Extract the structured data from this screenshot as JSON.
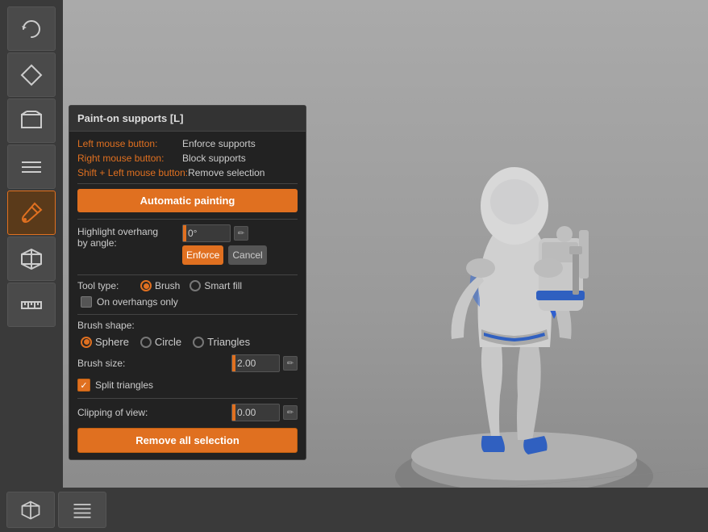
{
  "viewport": {
    "background": "#8c8c8c"
  },
  "toolbar": {
    "buttons": [
      {
        "id": "rotate",
        "icon": "↺",
        "label": "Rotate",
        "active": false
      },
      {
        "id": "diamond",
        "icon": "◇",
        "label": "Diamond",
        "active": false
      },
      {
        "id": "square",
        "icon": "▭",
        "label": "Square",
        "active": false
      },
      {
        "id": "layers",
        "icon": "≡",
        "label": "Layers",
        "active": false
      },
      {
        "id": "paintbrush",
        "icon": "🖌",
        "label": "Paint brush",
        "active": true
      },
      {
        "id": "cube",
        "icon": "⬡",
        "label": "Cube",
        "active": false
      },
      {
        "id": "ruler",
        "icon": "📏",
        "label": "Ruler",
        "active": false
      }
    ]
  },
  "panel": {
    "title": "Paint-on supports [L]",
    "left_mouse_label": "Left mouse button:",
    "left_mouse_value": "Enforce supports",
    "right_mouse_label": "Right mouse button:",
    "right_mouse_value": "Block supports",
    "shift_label": "Shift + Left mouse button:",
    "shift_value": "Remove selection",
    "auto_paint_btn": "Automatic painting",
    "highlight_label": "Highlight overhang",
    "by_angle_label": "by angle:",
    "angle_value": "0°",
    "enforce_btn": "Enforce",
    "cancel_btn": "Cancel",
    "tool_type_label": "Tool type:",
    "brush_label": "Brush",
    "smart_fill_label": "Smart fill",
    "on_overhangs_label": "On overhangs only",
    "brush_shape_label": "Brush shape:",
    "sphere_label": "Sphere",
    "circle_label": "Circle",
    "triangles_label": "Triangles",
    "brush_size_label": "Brush size:",
    "brush_size_value": "2.00",
    "split_triangles_label": "Split triangles",
    "clipping_label": "Clipping of view:",
    "clipping_value": "0.00",
    "remove_btn": "Remove all selection"
  },
  "bottom_toolbar": {
    "btn1": "⬡",
    "btn2": "≡"
  }
}
